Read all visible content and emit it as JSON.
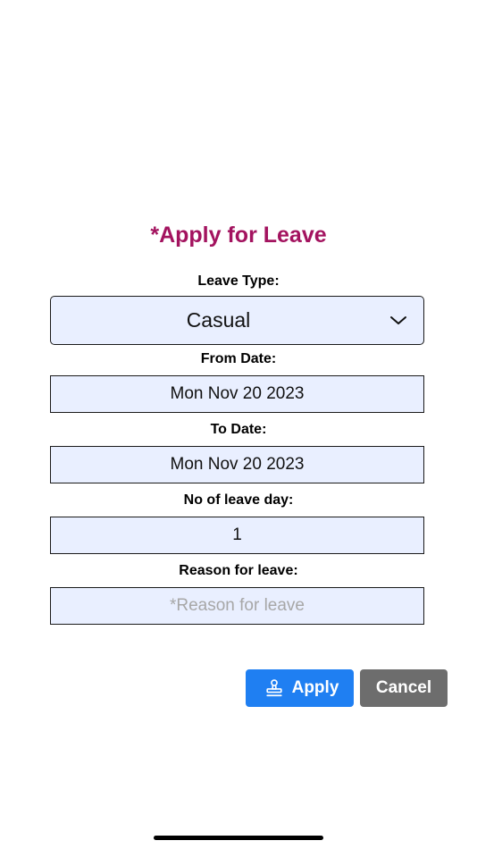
{
  "colors": {
    "title": "#a3135f",
    "field_bg": "#e9efff",
    "apply_bg": "#1f7ff2",
    "cancel_bg": "#6d6d6d"
  },
  "form": {
    "title": "*Apply for Leave",
    "leave_type": {
      "label": "Leave Type:",
      "value": "Casual",
      "icon": "chevron-down-icon"
    },
    "from_date": {
      "label": "From Date:",
      "value": "Mon Nov 20 2023"
    },
    "to_date": {
      "label": "To Date:",
      "value": "Mon Nov 20 2023"
    },
    "leave_days": {
      "label": "No of leave day:",
      "value": "1"
    },
    "reason": {
      "label": "Reason for leave:",
      "value": "",
      "placeholder": "*Reason for leave"
    }
  },
  "actions": {
    "apply_label": "Apply",
    "apply_icon": "stamp-icon",
    "cancel_label": "Cancel"
  }
}
